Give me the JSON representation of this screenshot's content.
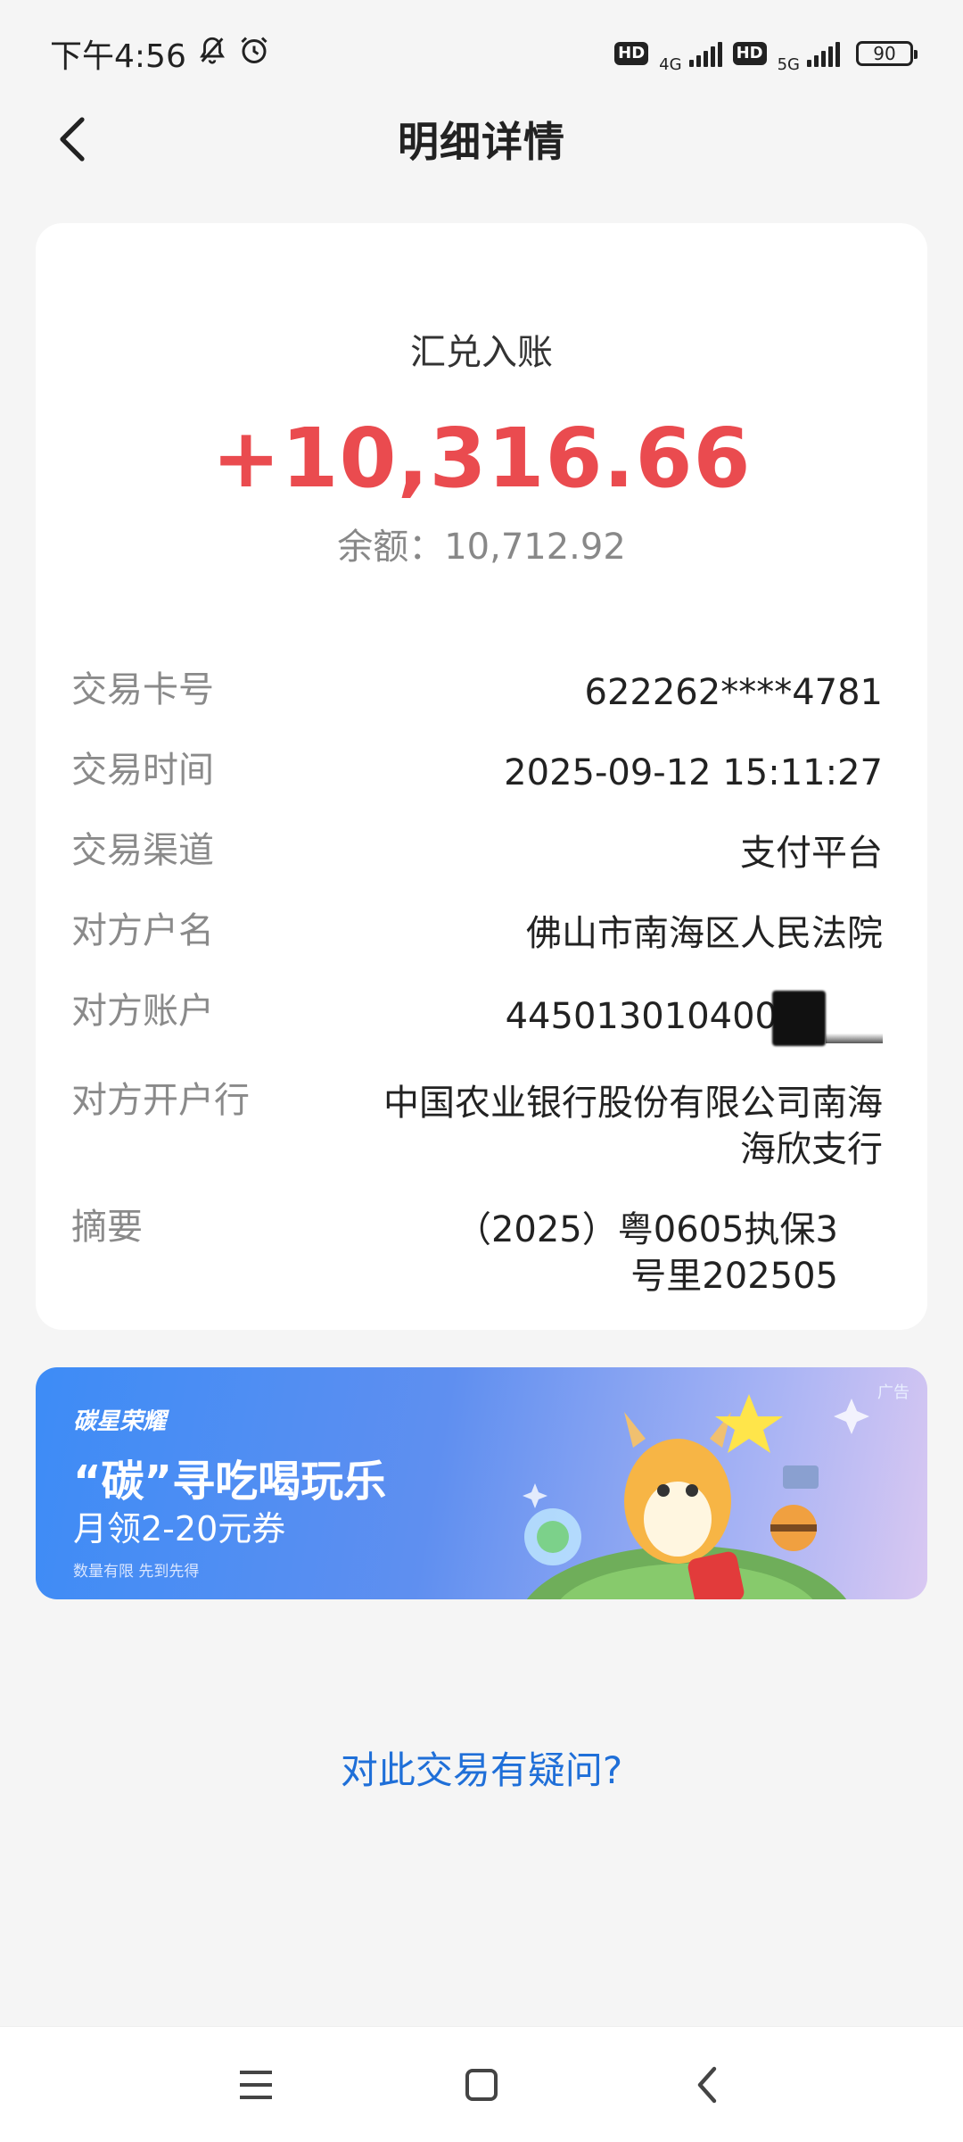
{
  "status_bar": {
    "time": "下午4:56",
    "hd1": "HD",
    "net1": "4G",
    "hd2": "HD",
    "net2": "5G",
    "battery": "90"
  },
  "header": {
    "title": "明细详情"
  },
  "transaction": {
    "type": "汇兑入账",
    "amount": "+10,316.66",
    "balance": "余额：10,712.92",
    "amount_color": "#ea4b4f"
  },
  "details": {
    "card_label": "交易卡号",
    "card_value": "622262****4781",
    "time_label": "交易时间",
    "time_value": "2025-09-12 15:11:27",
    "channel_label": "交易渠道",
    "channel_value": "支付平台",
    "payer_name_label": "对方户名",
    "payer_name_value": "佛山市南海区人民法院",
    "payer_account_label": "对方账户",
    "payer_account_value": "445013010400",
    "payer_bank_label": "对方开户行",
    "payer_bank_value": "中国农业银行股份有限公司南海海欣支行",
    "summary_label": "摘要",
    "summary_line1": "（2025）粤0605执保3",
    "summary_line2": "号里202505"
  },
  "ad": {
    "brand": "碳星荣耀",
    "headline": "“碳”寻吃喝玩乐",
    "subline": "月领2-20元券",
    "fineprint": "数量有限 先到先得",
    "tag": "广告"
  },
  "question_link": "对此交易有疑问?",
  "colors": {
    "link": "#1f6fd8",
    "background": "#f5f5f5"
  }
}
